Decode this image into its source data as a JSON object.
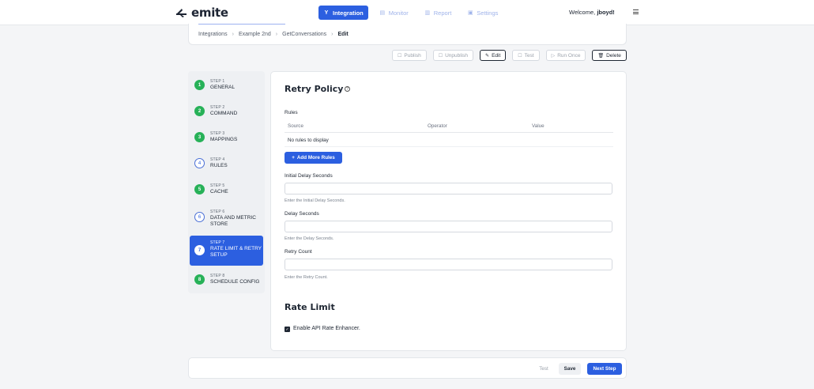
{
  "brand": {
    "name": "emite",
    "accent": "#2c5fe0"
  },
  "nav": {
    "tabs": [
      {
        "label": "Integration",
        "icon": "integration-icon",
        "active": true
      },
      {
        "label": "Monitor",
        "icon": "monitor-icon",
        "active": false
      },
      {
        "label": "Report",
        "icon": "report-icon",
        "active": false
      },
      {
        "label": "Settings",
        "icon": "settings-icon",
        "active": false
      }
    ],
    "welcome_prefix": "Welcome,",
    "username": "jboyd!"
  },
  "breadcrumb": {
    "items": [
      "Integrations",
      "Example 2nd",
      "GetConversations"
    ],
    "current": "Edit"
  },
  "actions": {
    "publish": "Publish",
    "unpublish": "Unpublish",
    "edit": "Edit",
    "test": "Test",
    "run_once": "Run Once",
    "delete": "Delete"
  },
  "steps": [
    {
      "num": "STEP 1",
      "name": "GENERAL",
      "badge": "1",
      "state": "done"
    },
    {
      "num": "STEP 2",
      "name": "COMMAND",
      "badge": "2",
      "state": "done"
    },
    {
      "num": "STEP 3",
      "name": "MAPPINGS",
      "badge": "3",
      "state": "done"
    },
    {
      "num": "STEP 4",
      "name": "RULES",
      "badge": "4",
      "state": "pending"
    },
    {
      "num": "STEP 5",
      "name": "CACHE",
      "badge": "5",
      "state": "done"
    },
    {
      "num": "STEP 6",
      "name": "DATA AND METRIC STORE",
      "badge": "6",
      "state": "pending"
    },
    {
      "num": "STEP 7",
      "name": "RATE LIMIT & RETRY SETUP",
      "badge": "7",
      "state": "current"
    },
    {
      "num": "STEP 8",
      "name": "SCHEDULE CONFIG",
      "badge": "8",
      "state": "done"
    }
  ],
  "retry": {
    "title": "Retry Policy",
    "rules_label": "Rules",
    "columns": [
      "Source",
      "Operator",
      "Value"
    ],
    "empty_text": "No rules to display",
    "add_button": "Add More Rules",
    "fields": [
      {
        "label": "Initial Delay Seconds",
        "value": "",
        "hint": "Enter the Initial Delay Seconds."
      },
      {
        "label": "Delay Seconds",
        "value": "",
        "hint": "Enter the Delay Seconds."
      },
      {
        "label": "Retry Count",
        "value": "",
        "hint": "Enter the Retry Count."
      }
    ]
  },
  "rate_limit": {
    "title": "Rate Limit",
    "checkbox_label": "Enable API Rate Enhancer.",
    "checked": true
  },
  "footer": {
    "test": "Test",
    "save": "Save",
    "next": "Next Step"
  }
}
